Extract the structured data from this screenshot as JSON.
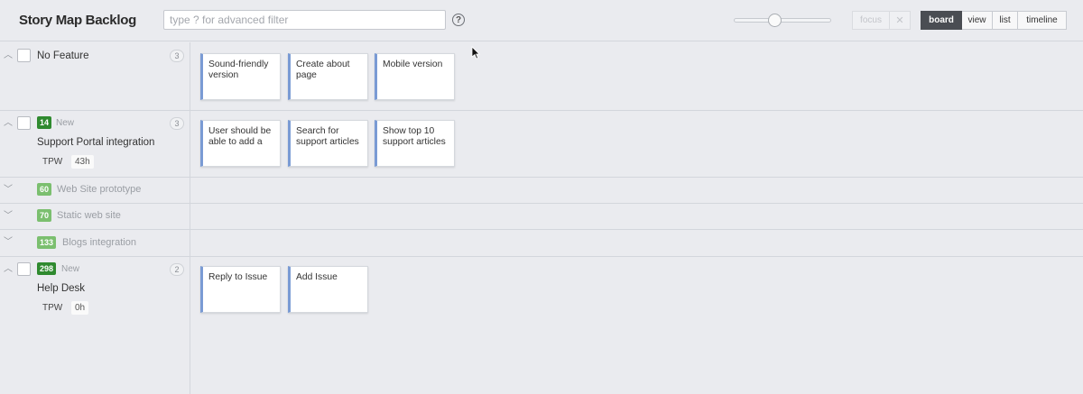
{
  "header": {
    "title": "Story Map Backlog",
    "search_placeholder": "type ? for advanced filter",
    "help_label": "?",
    "zoom_fraction": 0.42,
    "focus_label": "focus",
    "close_glyph": "✕",
    "views": [
      "board",
      "view",
      "list",
      "timeline"
    ],
    "active_view": "board"
  },
  "rows": [
    {
      "title": "No Feature",
      "count": "3",
      "cards": [
        "Sound-friendly version",
        "Create about page",
        "Mobile version"
      ]
    },
    {
      "id": "14",
      "state": "New",
      "title": "Support Portal integration",
      "count": "3",
      "team": "TPW",
      "hours": "43h",
      "cards": [
        "User should be able to add a",
        "Search for support articles",
        "Show top 10 support articles"
      ]
    },
    {
      "id": "60",
      "title": "Web Site prototype"
    },
    {
      "id": "70",
      "title": "Static web site"
    },
    {
      "id": "133",
      "title": "Blogs integration"
    },
    {
      "id": "298",
      "state": "New",
      "title": "Help Desk",
      "count": "2",
      "team": "TPW",
      "hours": "0h",
      "cards": [
        "Reply to Issue",
        "Add Issue"
      ]
    }
  ],
  "colors": {
    "badge_dark": "#2f8a2f",
    "badge_light": "#7bbf6f",
    "card_accent": "#7a9bd4",
    "active_view_bg": "#4a4d53"
  }
}
